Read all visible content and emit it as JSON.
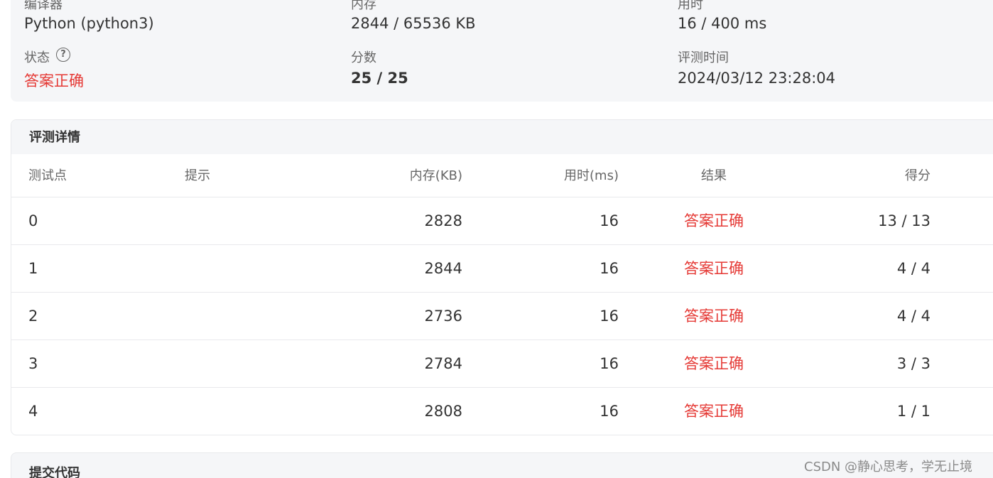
{
  "summary": {
    "compiler_label": "编译器",
    "compiler_value": "Python (python3)",
    "memory_label": "内存",
    "memory_value": "2844 / 65536 KB",
    "time_label": "用时",
    "time_value": "16 / 400 ms",
    "status_label": "状态",
    "status_value": "答案正确",
    "score_label": "分数",
    "score_value": "25 / 25",
    "judge_time_label": "评测时间",
    "judge_time_value": "2024/03/12 23:28:04"
  },
  "detail": {
    "title": "评测详情",
    "headers": {
      "case": "测试点",
      "hint": "提示",
      "memory": "内存(KB)",
      "time": "用时(ms)",
      "result": "结果",
      "score": "得分"
    },
    "rows": [
      {
        "case": "0",
        "hint": "",
        "memory": "2828",
        "time": "16",
        "result": "答案正确",
        "score": "13 / 13"
      },
      {
        "case": "1",
        "hint": "",
        "memory": "2844",
        "time": "16",
        "result": "答案正确",
        "score": "4 / 4"
      },
      {
        "case": "2",
        "hint": "",
        "memory": "2736",
        "time": "16",
        "result": "答案正确",
        "score": "4 / 4"
      },
      {
        "case": "3",
        "hint": "",
        "memory": "2784",
        "time": "16",
        "result": "答案正确",
        "score": "3 / 3"
      },
      {
        "case": "4",
        "hint": "",
        "memory": "2808",
        "time": "16",
        "result": "答案正确",
        "score": "1 / 1"
      }
    ]
  },
  "code": {
    "title": "提交代码"
  },
  "watermark": "CSDN @静心思考，学无止境",
  "colors": {
    "accepted": "#e53935",
    "card_bg": "#f5f6f8"
  }
}
